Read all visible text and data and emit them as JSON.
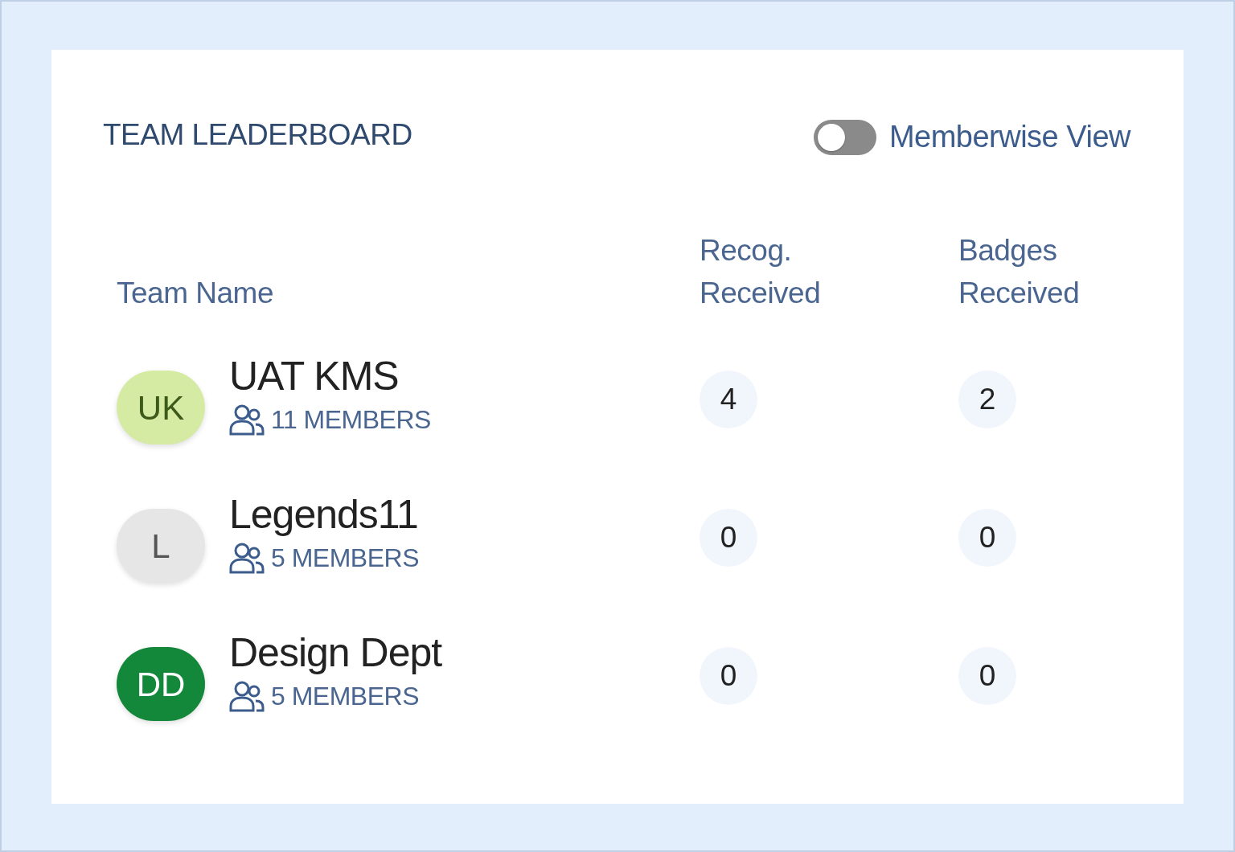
{
  "title": "TEAM LEADERBOARD",
  "memberwise_toggle": {
    "label": "Memberwise View",
    "on": false
  },
  "columns": [
    "Team Name",
    "Recog. Received",
    "Badges Received"
  ],
  "teams": [
    {
      "initials": "UK",
      "color": "#d5eba3",
      "name": "UAT KMS",
      "members": "11 MEMBERS",
      "recognitions": "4",
      "badges": "2"
    },
    {
      "initials": "L",
      "color": "#e6e6e6",
      "name": "Legends11",
      "members": "5 MEMBERS",
      "recognitions": "0",
      "badges": "0"
    },
    {
      "initials": "DD",
      "color": "#14883a",
      "name": "Design Dept",
      "members": "5 MEMBERS",
      "recognitions": "0",
      "badges": "0"
    }
  ]
}
